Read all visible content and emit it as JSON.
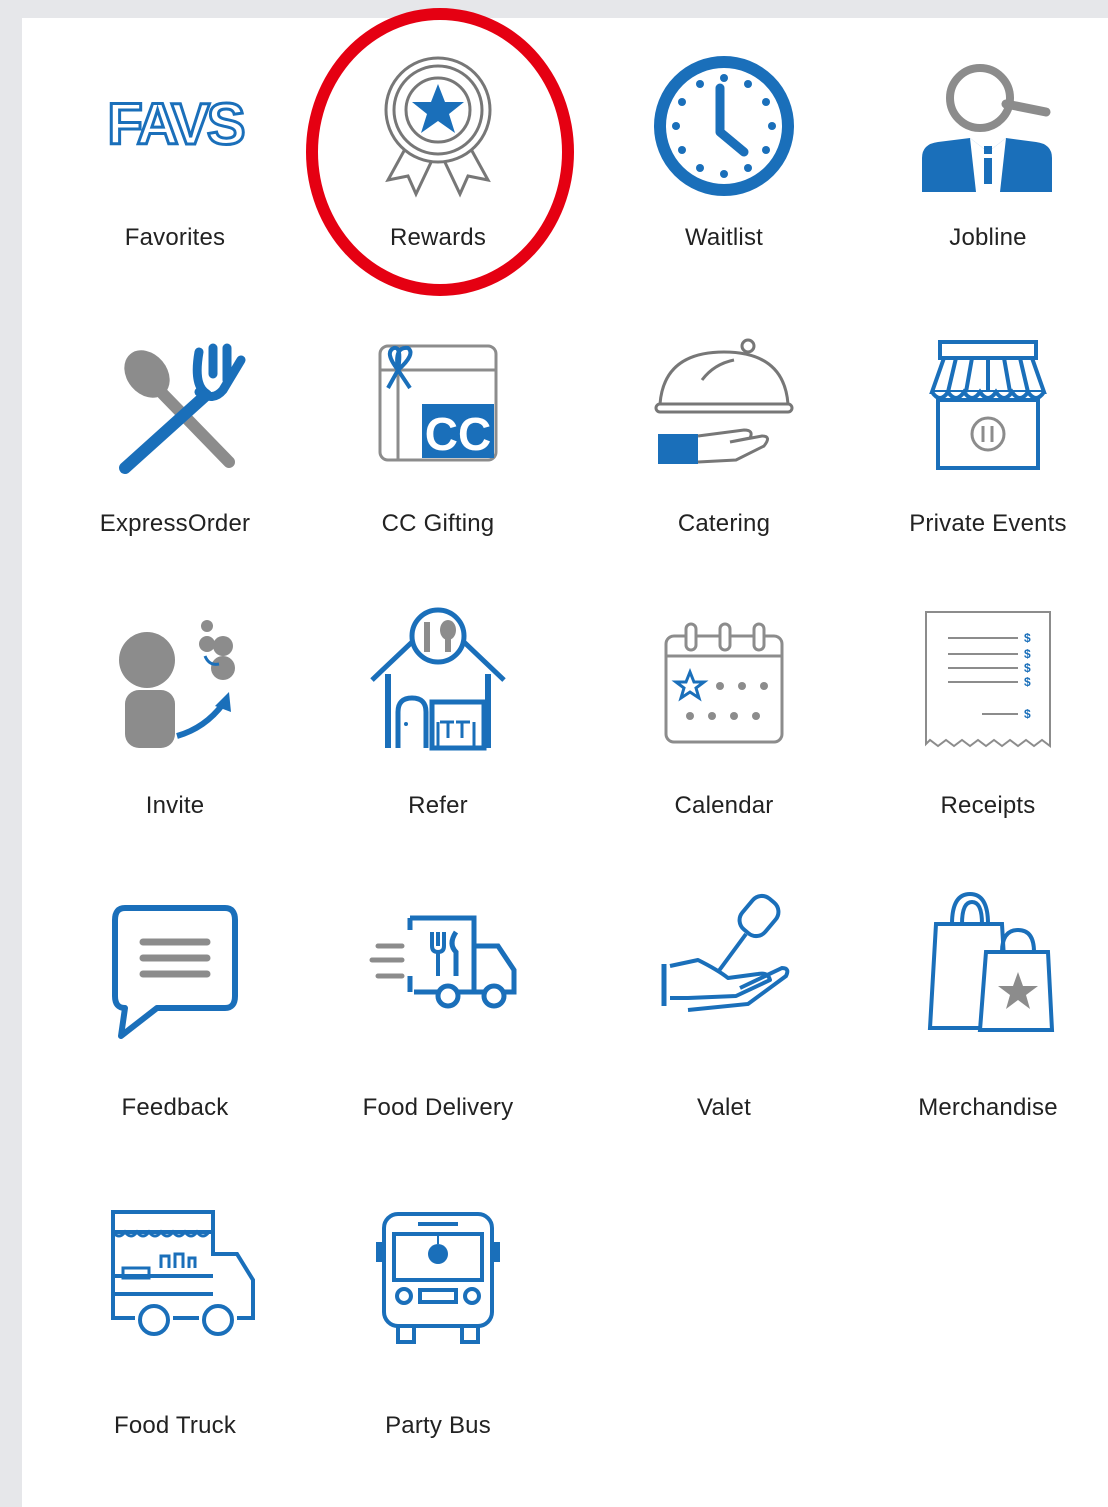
{
  "colors": {
    "accent": "#1a6fba",
    "gray": "#8c8c8c",
    "highlight": "#e50012"
  },
  "favs_text": "FAVS",
  "tiles": [
    {
      "label": "Favorites",
      "icon": "favs-icon"
    },
    {
      "label": "Rewards",
      "icon": "award-ribbon-icon"
    },
    {
      "label": "Waitlist",
      "icon": "clock-icon"
    },
    {
      "label": "Jobline",
      "icon": "job-search-icon"
    },
    {
      "label": "ExpressOrder",
      "icon": "utensils-icon"
    },
    {
      "label": "CC Gifting",
      "icon": "gift-card-icon"
    },
    {
      "label": "Catering",
      "icon": "cloche-icon"
    },
    {
      "label": "Private Events",
      "icon": "storefront-icon"
    },
    {
      "label": "Invite",
      "icon": "invite-person-icon"
    },
    {
      "label": "Refer",
      "icon": "restaurant-building-icon"
    },
    {
      "label": "Calendar",
      "icon": "calendar-icon"
    },
    {
      "label": "Receipts",
      "icon": "receipt-icon"
    },
    {
      "label": "Feedback",
      "icon": "chat-bubble-icon"
    },
    {
      "label": "Food Delivery",
      "icon": "delivery-truck-icon"
    },
    {
      "label": "Valet",
      "icon": "car-key-hand-icon"
    },
    {
      "label": "Merchandise",
      "icon": "shopping-bags-icon"
    },
    {
      "label": "Food Truck",
      "icon": "food-truck-icon"
    },
    {
      "label": "Party Bus",
      "icon": "bus-icon"
    }
  ]
}
